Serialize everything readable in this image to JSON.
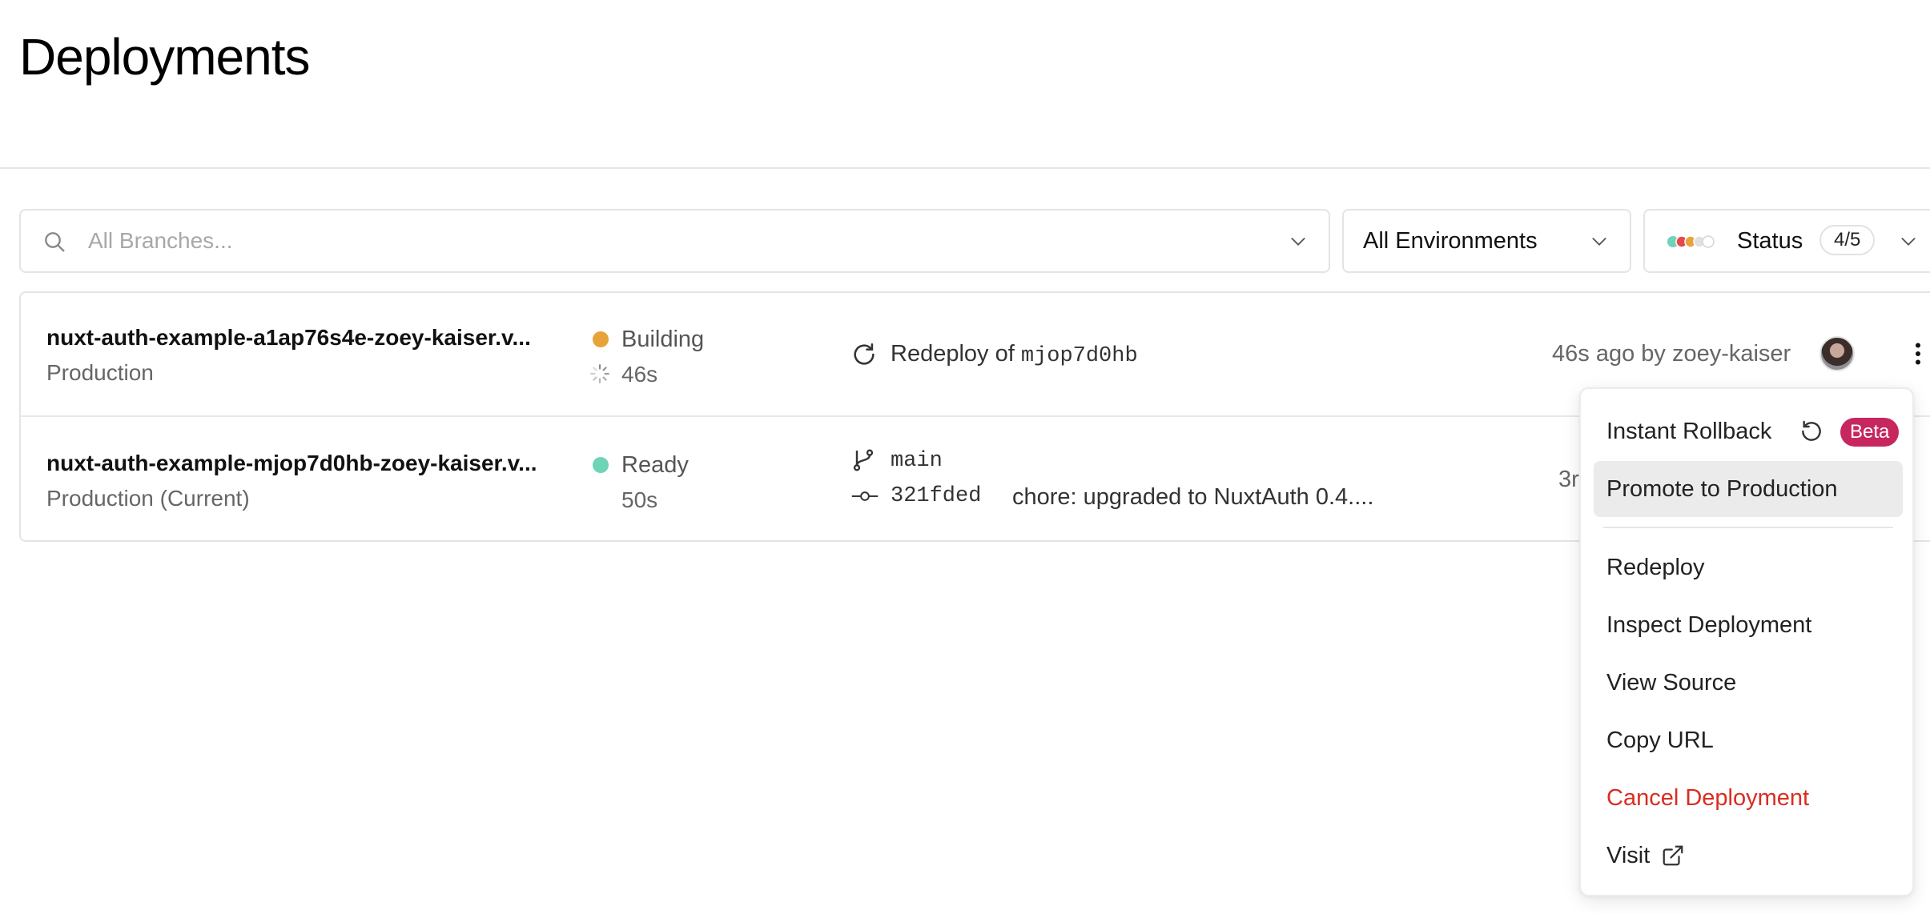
{
  "page": {
    "title": "Deployments"
  },
  "filters": {
    "branch": {
      "placeholder": "All Branches..."
    },
    "environment": {
      "selected": "All Environments"
    },
    "status": {
      "label": "Status",
      "count": "4/5",
      "dot_colors": [
        "#6fd3b8",
        "#e5484d",
        "#e8a23a",
        "#e0e0e0",
        "#ffffff"
      ]
    }
  },
  "deployments": [
    {
      "url": "nuxt-auth-example-a1ap76s4e-zoey-kaiser.v...",
      "environment": "Production",
      "state": "Building",
      "state_color": "#e8a23a",
      "duration": "46s",
      "source_prefix": "Redeploy of",
      "source_ref": "mjop7d0hb",
      "age": "46s ago by zoey-kaiser"
    },
    {
      "url": "nuxt-auth-example-mjop7d0hb-zoey-kaiser.v...",
      "environment": "Production (Current)",
      "state": "Ready",
      "state_color": "#6fd3b8",
      "duration": "50s",
      "branch": "main",
      "commit_sha": "321fded",
      "commit_message": "chore: upgraded to NuxtAuth 0.4....",
      "age": "3r"
    }
  ],
  "menu": {
    "items": [
      {
        "label": "Instant Rollback",
        "badge": "Beta"
      },
      {
        "label": "Promote to Production"
      },
      {
        "label": "Redeploy"
      },
      {
        "label": "Inspect Deployment"
      },
      {
        "label": "View Source"
      },
      {
        "label": "Copy URL"
      },
      {
        "label": "Cancel Deployment",
        "color": "#d92d20"
      },
      {
        "label": "Visit"
      }
    ]
  }
}
